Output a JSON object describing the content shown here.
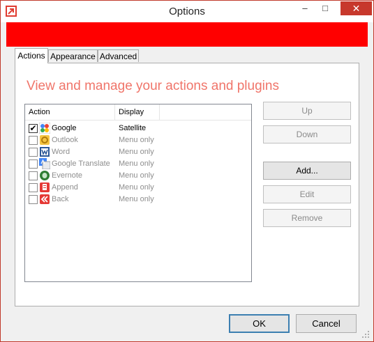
{
  "window": {
    "title": "Options"
  },
  "titlebar": {
    "minimize_glyph": "–",
    "maximize_glyph": "□",
    "close_glyph": "✕"
  },
  "colors": {
    "banner": "#ff0000",
    "heading": "#f0756a",
    "accent": "#e03c31"
  },
  "tabs": [
    {
      "label": "Actions",
      "active": true
    },
    {
      "label": "Appearance",
      "active": false
    },
    {
      "label": "Advanced",
      "active": false
    }
  ],
  "panel": {
    "heading": "View and manage your actions and plugins"
  },
  "list": {
    "columns": {
      "action": "Action",
      "display": "Display"
    },
    "rows": [
      {
        "name": "Google",
        "display": "Satellite",
        "checked": true,
        "enabled": true,
        "icon": "google-icon",
        "check_glyph": "✔"
      },
      {
        "name": "Outlook",
        "display": "Menu only",
        "checked": false,
        "enabled": false,
        "icon": "outlook-icon"
      },
      {
        "name": "Word",
        "display": "Menu only",
        "checked": false,
        "enabled": false,
        "icon": "word-icon"
      },
      {
        "name": "Google Translate",
        "display": "Menu only",
        "checked": false,
        "enabled": false,
        "icon": "google-translate-icon"
      },
      {
        "name": "Evernote",
        "display": "Menu only",
        "checked": false,
        "enabled": false,
        "icon": "evernote-icon"
      },
      {
        "name": "Append",
        "display": "Menu only",
        "checked": false,
        "enabled": false,
        "icon": "append-icon"
      },
      {
        "name": "Back",
        "display": "Menu only",
        "checked": false,
        "enabled": false,
        "icon": "back-icon"
      }
    ]
  },
  "side_buttons": {
    "up": "Up",
    "down": "Down",
    "add": "Add...",
    "edit": "Edit",
    "remove": "Remove"
  },
  "footer": {
    "ok": "OK",
    "cancel": "Cancel"
  }
}
